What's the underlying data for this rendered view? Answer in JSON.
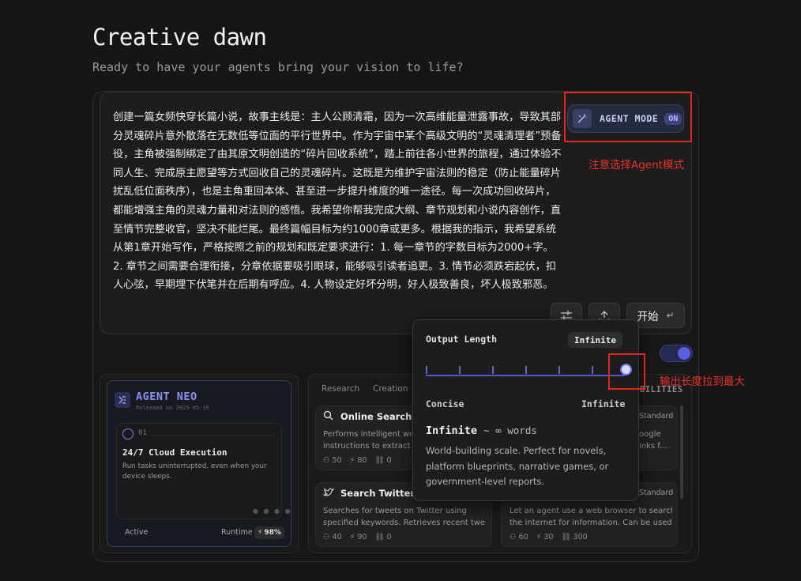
{
  "header": {
    "title": "Creative dawn",
    "subtitle": "Ready to have your agents bring your vision to life?"
  },
  "prompt": {
    "text": "创建一篇女频快穿长篇小说，故事主线是：主人公顾清霜，因为一次高维能量泄露事故，导致其部分灵魂碎片意外散落在无数低等位面的平行世界中。作为宇宙中某个高级文明的“灵魂清理者”预备役，主角被强制绑定了由其原文明创造的“碎片回收系统”，踏上前往各小世界的旅程，通过体验不同人生、完成原主愿望等方式回收自己的灵魂碎片。这既是为维护宇宙法则的稳定（防止能量碎片扰乱低位面秩序），也是主角重回本体、甚至进一步提升维度的唯一途径。每一次成功回收碎片，都能增强主角的灵魂力量和对法则的感悟。我希望你帮我完成大纲、章节规划和小说内容创作，直至情节完整收官，坚决不能烂尾。最终篇幅目标为约1000章或更多。根据我的指示，我希望系统从第1章开始写作，严格按照之前的规划和既定要求进行：1. 每一章节的字数目标为2000+字。2. 章节之间需要合理衔接，分章依据要吸引眼球，能够吸引读者追更。3. 情节必须跌宕起伏，扣人心弦，早期埋下伏笔并在后期有呼应。4. 人物设定好坏分明，好人极致善良，坏人极致邪恶。"
  },
  "agent_mode": {
    "label": "AGENT MODE",
    "state": "ON"
  },
  "annotations": {
    "agent_note": "注意选择Agent模式",
    "slider_note": "输出长度拉到最大"
  },
  "actions": {
    "start_label": "开始",
    "start_icon": "↵"
  },
  "agent_card": {
    "name": "AGENT NEO",
    "release": "Released on 2025-05-19",
    "feature_number": "01",
    "feature_title": "24/7 Cloud Execution",
    "feature_desc": "Run tasks uninterrupted, even when your device sleeps.",
    "status": "Active",
    "runtime_label": "Runtime",
    "runtime_value": "98%"
  },
  "capabilities": {
    "tabs": [
      "Research",
      "Creation"
    ],
    "header_right": "BILITIES",
    "cards": [
      {
        "title": "Online Search",
        "desc1": "Performs intelligent web",
        "desc2": "instructions to extract ke",
        "stats": [
          "50",
          "80",
          "0"
        ]
      },
      {
        "title": "Search Twitter",
        "desc1": "Searches for tweets on Twitter using",
        "desc2": "specified keywords. Retrieves recent twee...",
        "stats": [
          "40",
          "90",
          "0"
        ]
      },
      {
        "badge": "Standard",
        "desc1": "oogle",
        "desc2": "inks f...",
        "stats": []
      },
      {
        "badge": "Standard",
        "desc1": "Let an agent use a web browser to search",
        "desc2": "the internet for information. Can be used...",
        "stats": [
          "60",
          "30",
          "300"
        ]
      }
    ]
  },
  "output_length": {
    "title": "Output Length",
    "current_value": "Infinite",
    "level": 1.0,
    "min_label": "Concise",
    "max_label": "Infinite",
    "option_title": "Infinite",
    "option_range": "~ ∞ words",
    "option_desc": "World-building scale. Perfect for novels, platform blueprints, narrative games, or government-level reports."
  }
}
